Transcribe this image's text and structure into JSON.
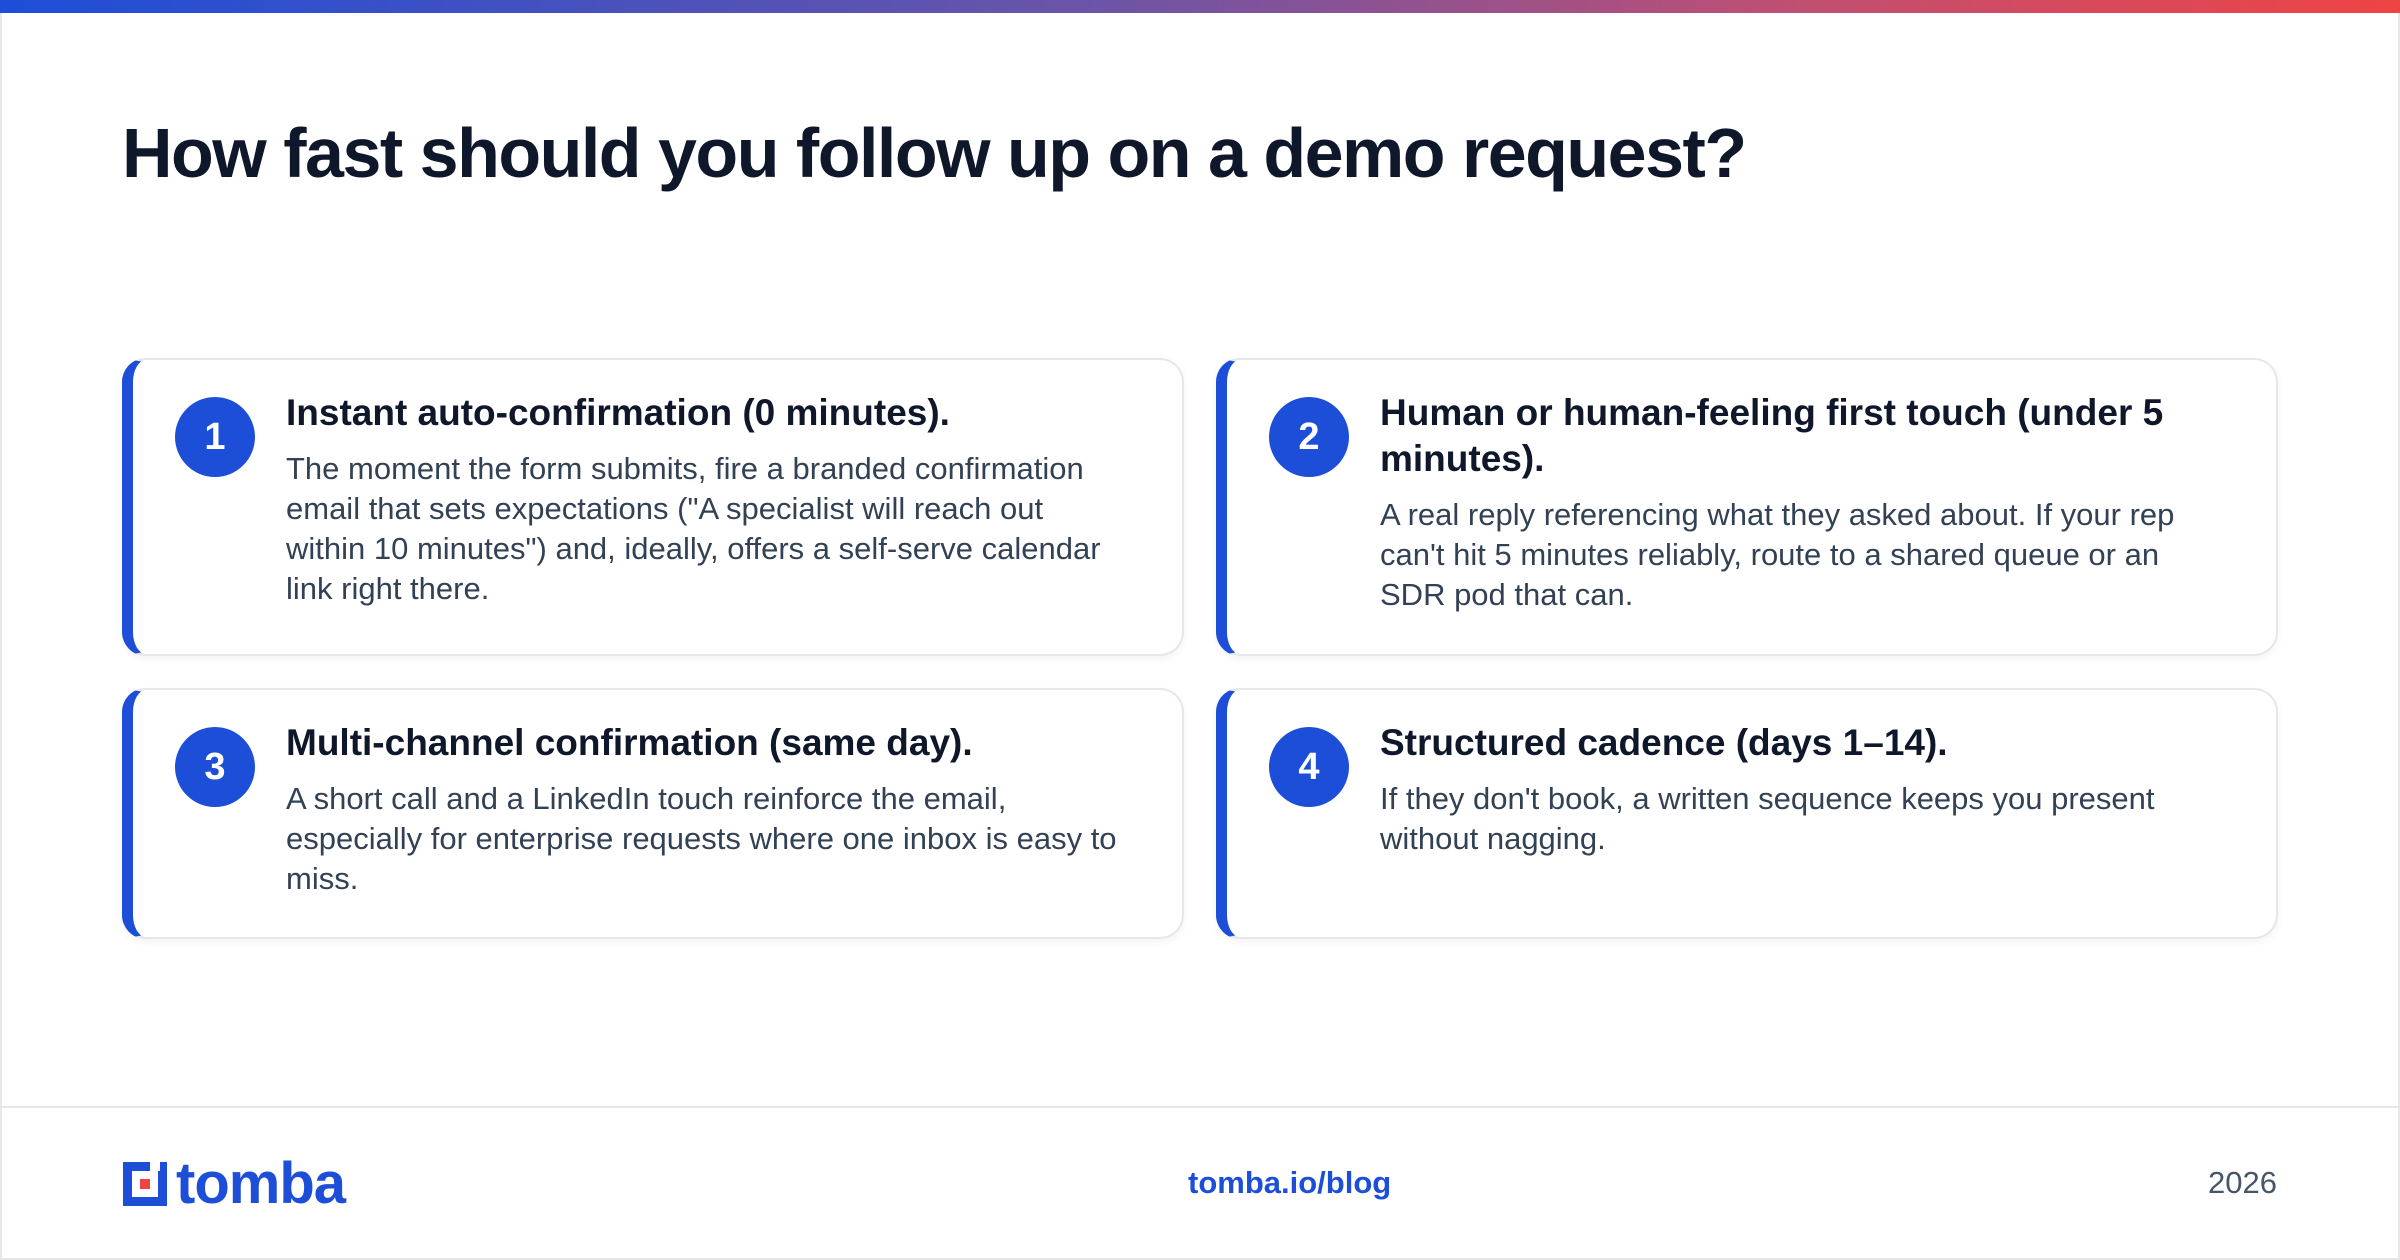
{
  "page": {
    "title": "How fast should you follow up on a demo request?"
  },
  "cards": [
    {
      "number": "1",
      "title": "Instant auto-confirmation (0 minutes).",
      "body": "The moment the form submits, fire a branded confirmation email that sets expectations (\"A specialist will reach out within 10 minutes\") and, ideally, offers a self-serve calendar link right there."
    },
    {
      "number": "2",
      "title": "Human or human-feeling first touch (under 5 minutes).",
      "body": "A real reply referencing what they asked about. If your rep can't hit 5 minutes reliably, route to a shared queue or an SDR pod that can."
    },
    {
      "number": "3",
      "title": "Multi-channel confirmation (same day).",
      "body": "A short call and a LinkedIn touch reinforce the email, especially for enterprise requests where one inbox is easy to miss."
    },
    {
      "number": "4",
      "title": "Structured cadence (days 1–14).",
      "body": "If they don't book, a written sequence keeps you present without nagging."
    }
  ],
  "footer": {
    "logo_text": "tomba",
    "link": "tomba.io/blog",
    "year": "2026"
  },
  "colors": {
    "accent": "#1d4ed8",
    "title": "#0f172a",
    "body": "#334155",
    "muted": "#475569",
    "border": "#e5e7eb",
    "gradient_end": "#ef4444"
  },
  "icons": {
    "logo": "tomba-logo-icon"
  }
}
